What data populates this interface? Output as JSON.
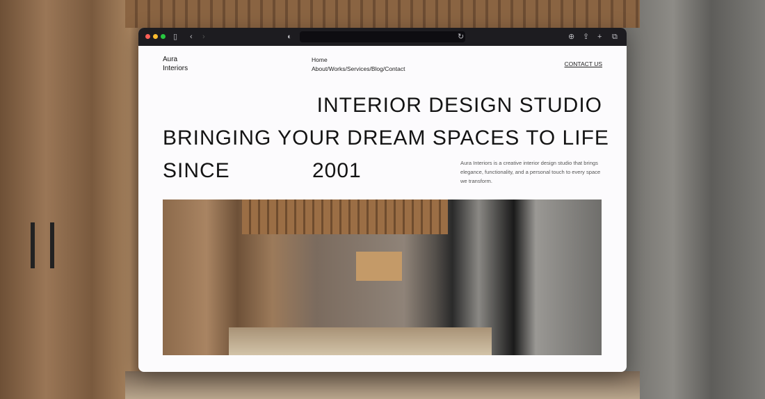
{
  "browser": {
    "traffic_lights": [
      "#ff5f57",
      "#febc2e",
      "#28c840"
    ]
  },
  "site": {
    "logo_line1": "Aura",
    "logo_line2": "Interiors",
    "nav": {
      "home": "Home",
      "links": "About/Works/Services/Blog/Contact"
    },
    "contact": "CONTACT US",
    "headline1": "INTERIOR DESIGN STUDIO",
    "headline2": "BRINGING YOUR DREAM SPACES TO LIFE",
    "headline3a": "SINCE",
    "headline3b": "2001",
    "description": "Aura Interiors is a creative interior design studio that brings elegance, functionality, and a personal touch to every space we transform."
  }
}
